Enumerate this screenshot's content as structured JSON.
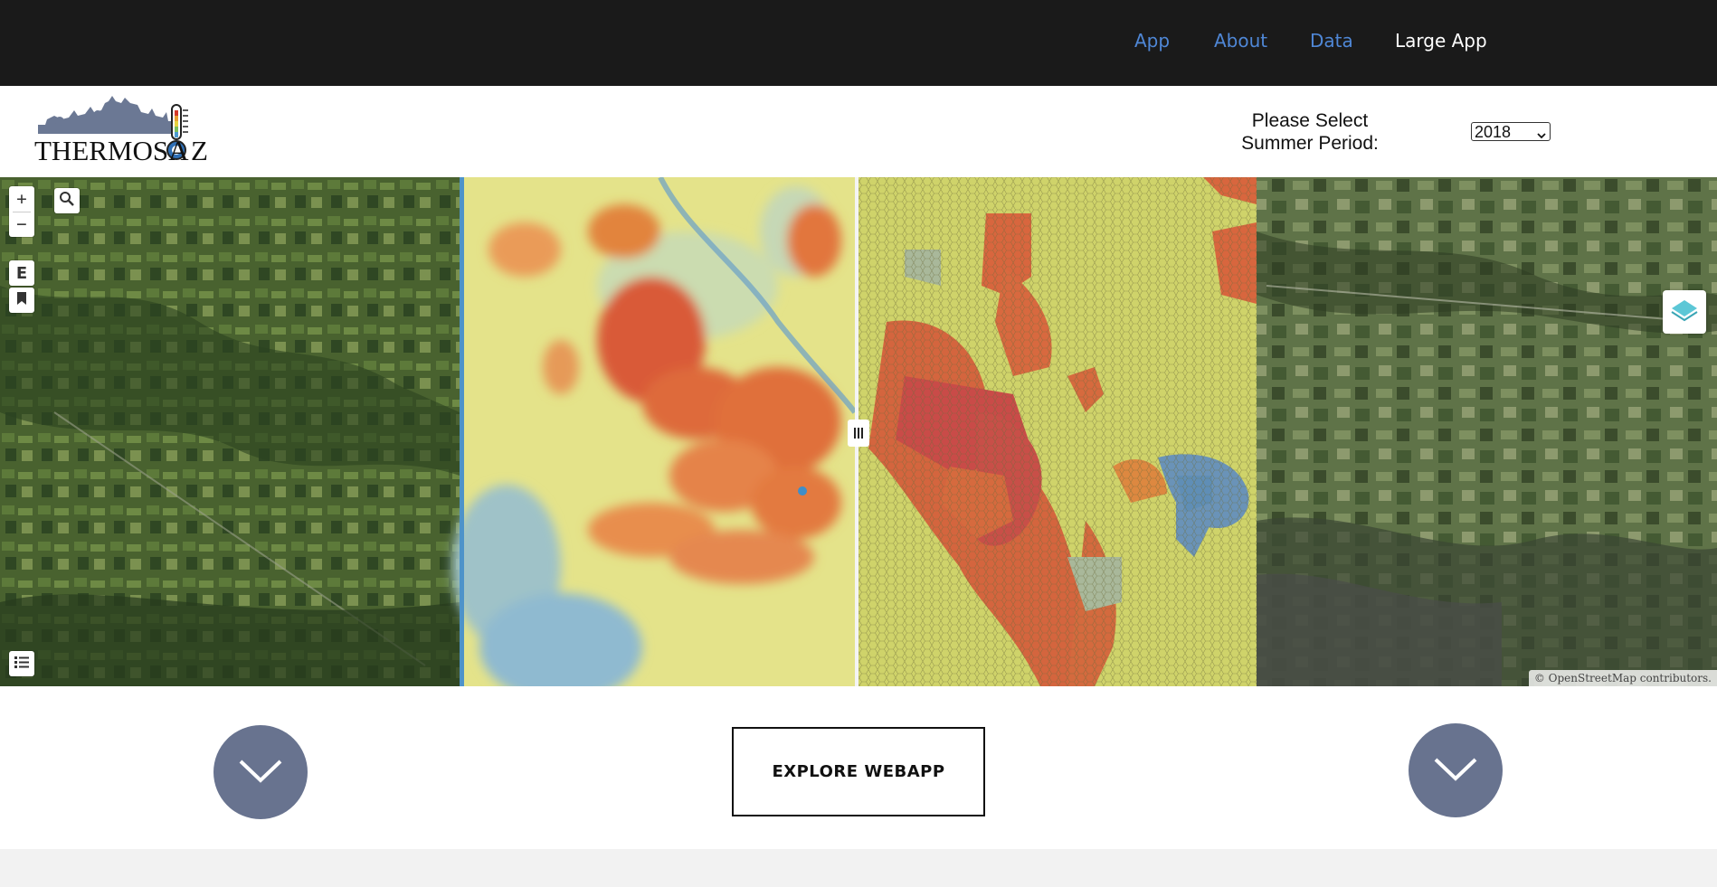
{
  "nav": {
    "items": [
      {
        "label": "App"
      },
      {
        "label": "About"
      },
      {
        "label": "Data"
      },
      {
        "label": "Large App"
      }
    ]
  },
  "header": {
    "logo_text": "THERMOSA Z",
    "select_label_line1": "Please Select",
    "select_label_line2": "Summer Period:",
    "selected_year": "2018"
  },
  "map": {
    "zoom_in_label": "+",
    "zoom_out_label": "−",
    "export_label": "E",
    "attribution": "© OpenStreetMap contributors.",
    "icons": {
      "search": "search-icon",
      "bookmark": "bookmark-icon",
      "legend": "list-icon",
      "layers": "layers-icon",
      "swipe": "swipe-handle-icon"
    }
  },
  "bottom": {
    "explore_label": "EXPLORE WEBAPP",
    "left_button_icon": "chevron-down-icon",
    "right_button_icon": "chevron-down-icon"
  },
  "colors": {
    "nav_bg": "#1a1a1a",
    "nav_link": "#4f87d6",
    "nav_active": "#ffffff",
    "brand_slate": "#68738f"
  }
}
